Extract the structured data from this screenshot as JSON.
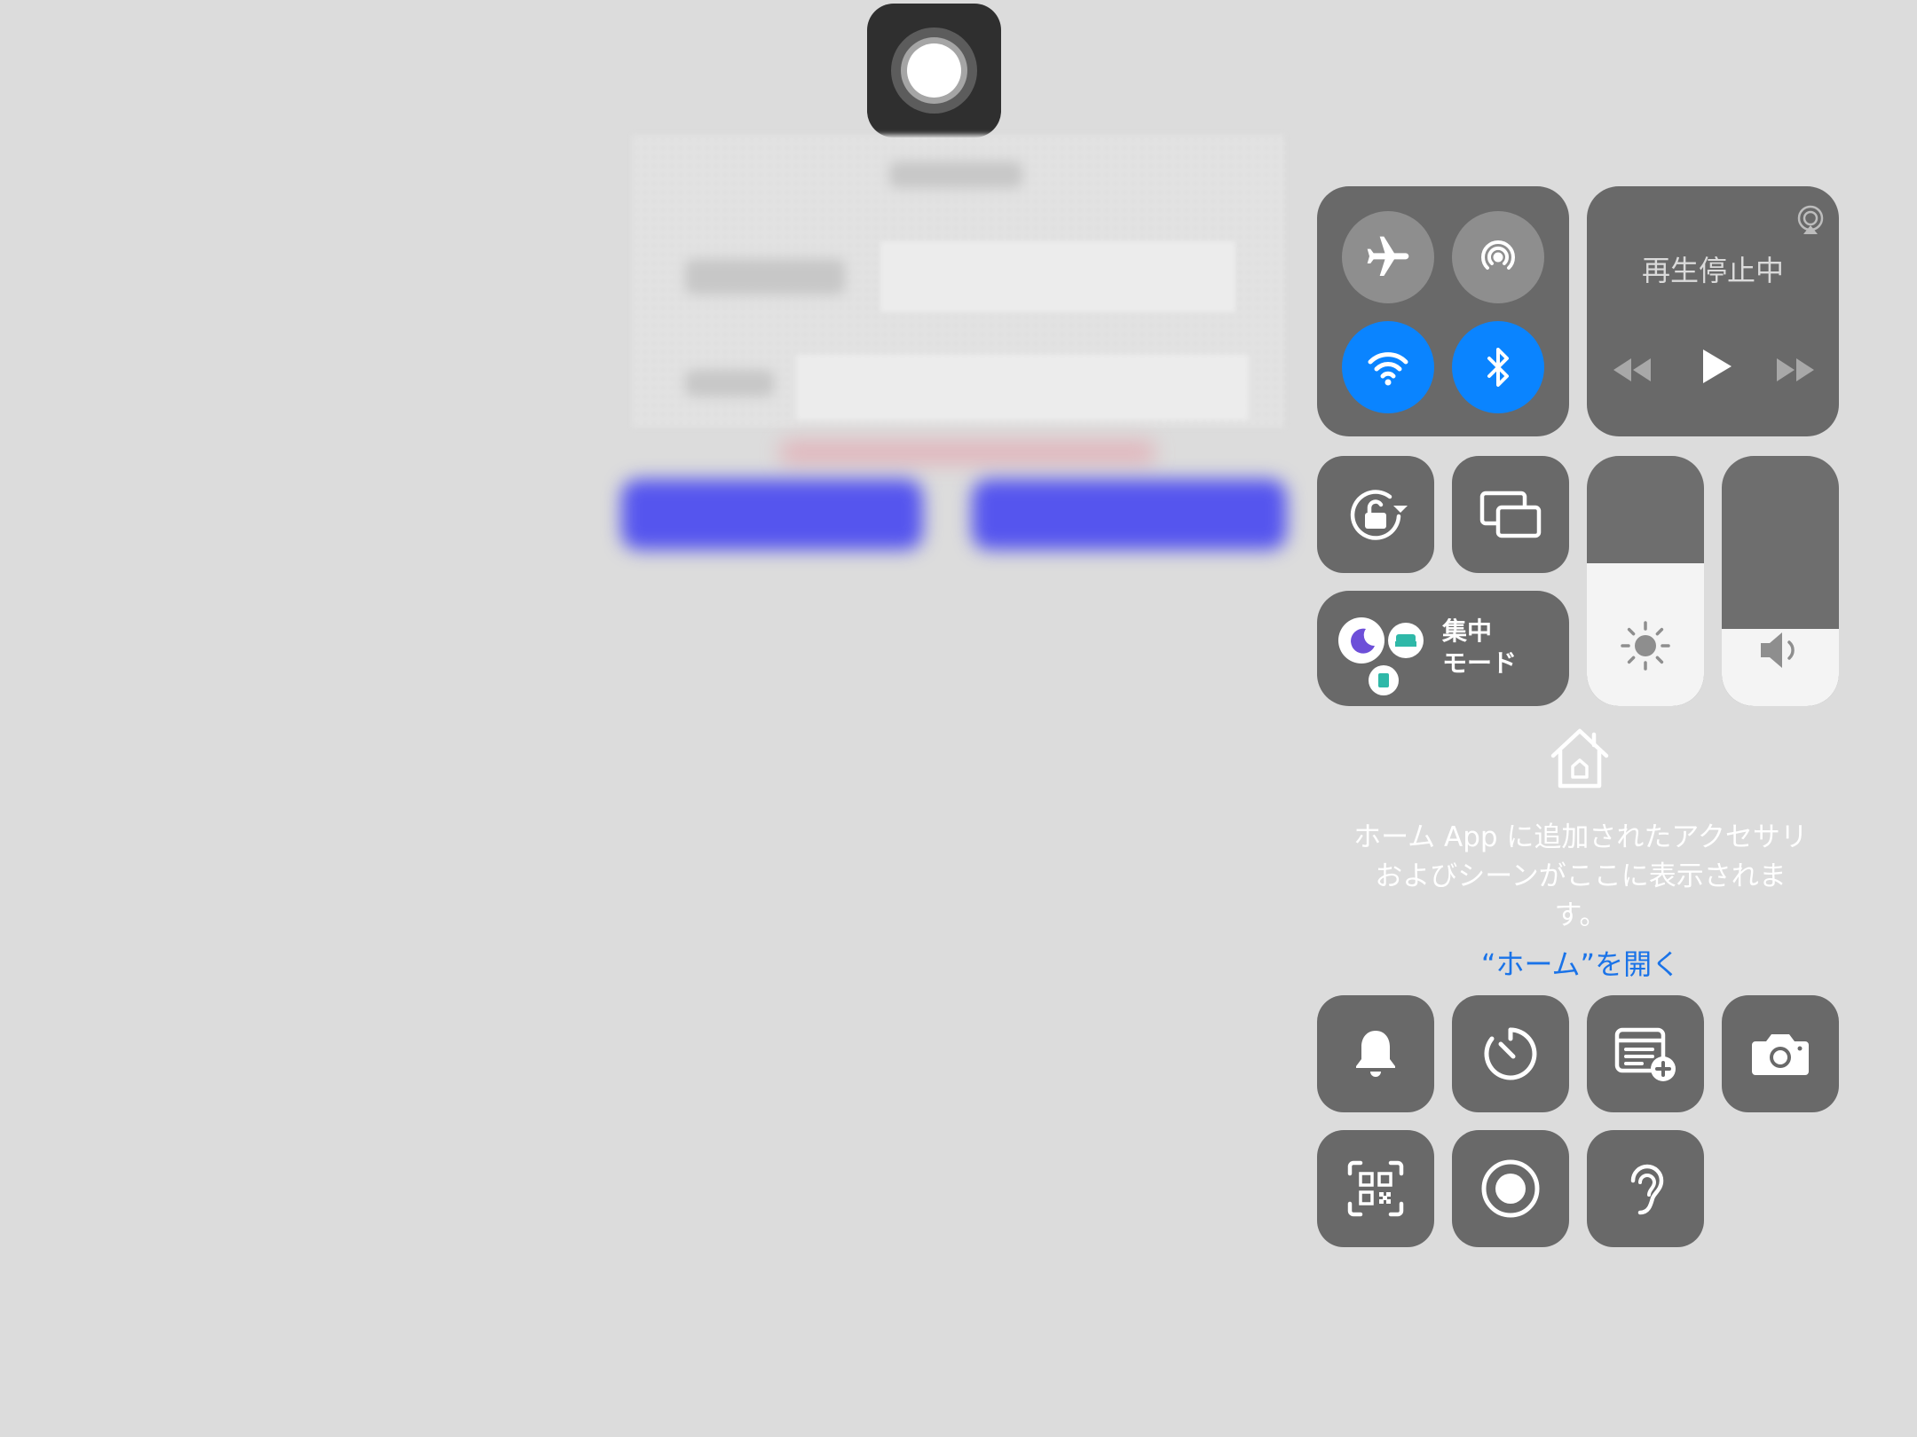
{
  "media": {
    "status": "再生停止中"
  },
  "focus": {
    "line1": "集中",
    "line2": "モード"
  },
  "home": {
    "message_lines": [
      "ホーム App に追加されたアクセサリ",
      "およびシーンがここに表示されま",
      "す。"
    ],
    "open_link": "“ホーム”を開く"
  },
  "levels": {
    "brightness": 0.57,
    "volume": 0.31
  },
  "connectivity": {
    "airplane_mode": false,
    "airdrop": false,
    "wifi": true,
    "bluetooth": true
  },
  "colors": {
    "accent": "#0a84ff",
    "module_bg": "#696969",
    "link": "#1a73e8"
  },
  "icons": {
    "connectivity": [
      "airplane-icon",
      "airdrop-icon",
      "wifi-icon",
      "bluetooth-icon"
    ],
    "media": [
      "airplay-icon",
      "rewind-icon",
      "play-icon",
      "fast-forward-icon"
    ],
    "tiles": [
      "rotation-lock-icon",
      "screen-mirroring-icon",
      "sun-icon",
      "speaker-icon",
      "moon-icon",
      "bed-icon",
      "person-icon",
      "home-icon"
    ],
    "bottom": [
      "bell-icon",
      "timer-icon",
      "quick-note-icon",
      "camera-icon",
      "qr-code-icon",
      "screen-record-icon",
      "ear-icon"
    ]
  }
}
